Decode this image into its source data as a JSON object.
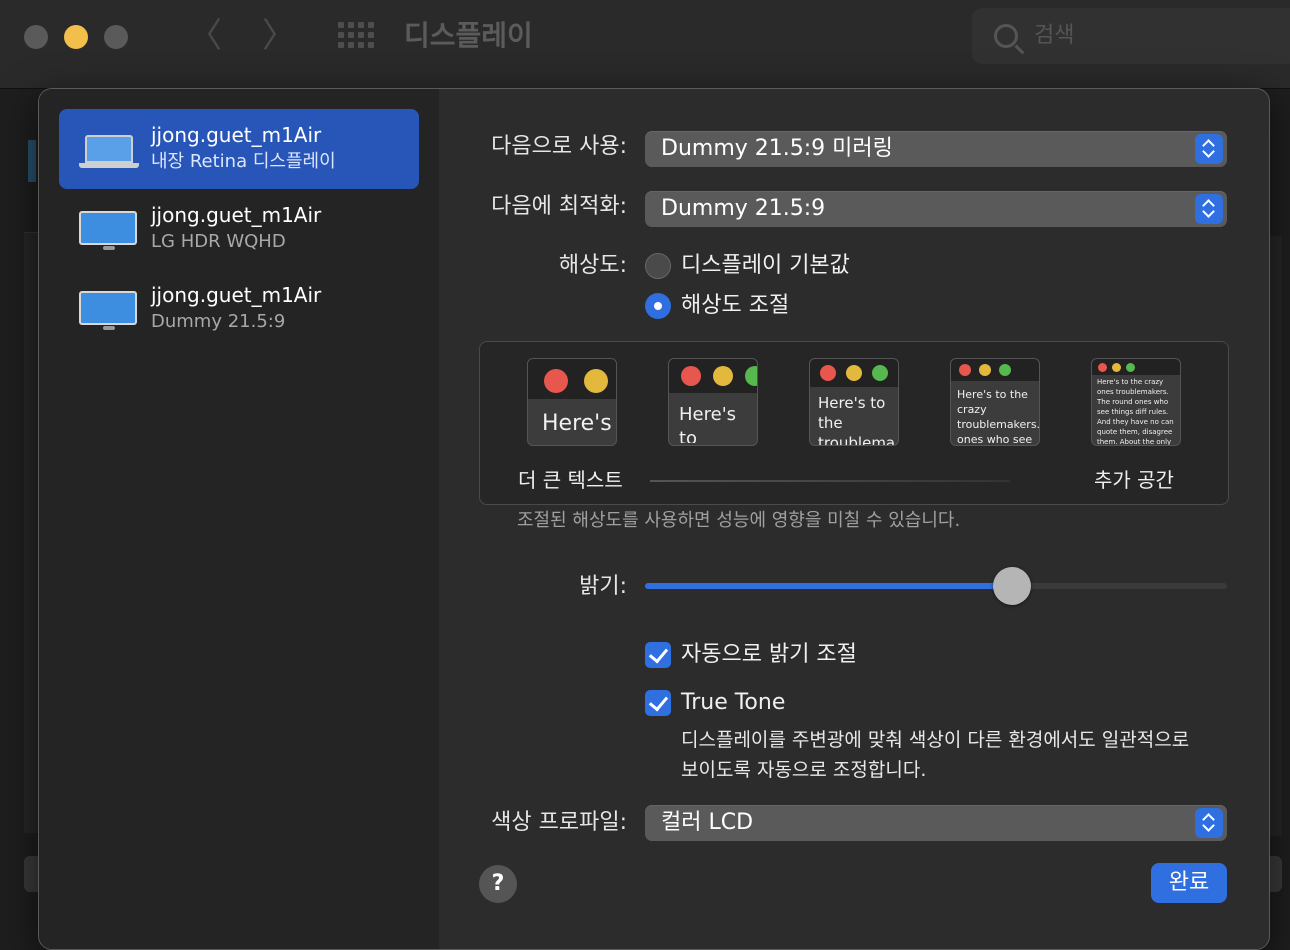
{
  "window": {
    "title": "디스플레이",
    "search_placeholder": "검색"
  },
  "sidebar": {
    "items": [
      {
        "name": "jjong.guet_m1Air",
        "sub": "내장 Retina 디스플레이",
        "selected": true,
        "icon": "laptop-icon"
      },
      {
        "name": "jjong.guet_m1Air",
        "sub": "LG HDR WQHD",
        "selected": false,
        "icon": "monitor-icon"
      },
      {
        "name": "jjong.guet_m1Air",
        "sub": "Dummy 21.5:9",
        "selected": false,
        "icon": "monitor-icon"
      }
    ]
  },
  "settings": {
    "use_as_label": "다음으로 사용:",
    "use_as_value": "Dummy 21.5:9 미러링",
    "optimize_label": "다음에 최적화:",
    "optimize_value": "Dummy 21.5:9",
    "resolution_label": "해상도:",
    "resolution_default": "디스플레이 기본값",
    "resolution_scaled": "해상도 조절",
    "resolution_selected": "해상도 조절",
    "scale": {
      "larger_text": "더 큰 텍스트",
      "more_space": "추가 공간",
      "previews": [
        "Here's",
        "Here's to troublem",
        "Here's to the troublema ones who",
        "Here's to the crazy troublemakers. ones who see t rules. And they",
        "Here's to the crazy ones troublemakers. The round ones who see things diff rules. And they have no can quote them, disagree them. About the only thi Because they change thi"
      ]
    },
    "performance_note": "조절된 해상도를 사용하면 성능에 영향을 미칠 수 있습니다.",
    "brightness_label": "밝기:",
    "brightness_level": 0.63,
    "auto_brightness": "자동으로 밝기 조절",
    "auto_brightness_checked": true,
    "true_tone": "True Tone",
    "true_tone_checked": true,
    "true_tone_desc": "디스플레이를 주변광에 맞춰 색상이 다른 환경에서도 일관적으로 보이도록 자동으로 조정합니다.",
    "color_profile_label": "색상 프로파일:",
    "color_profile_value": "컬러 LCD"
  },
  "footer": {
    "help": "?",
    "done": "완료"
  },
  "colors": {
    "accent": "#2f6fe0",
    "selected_row": "#2855b8"
  }
}
